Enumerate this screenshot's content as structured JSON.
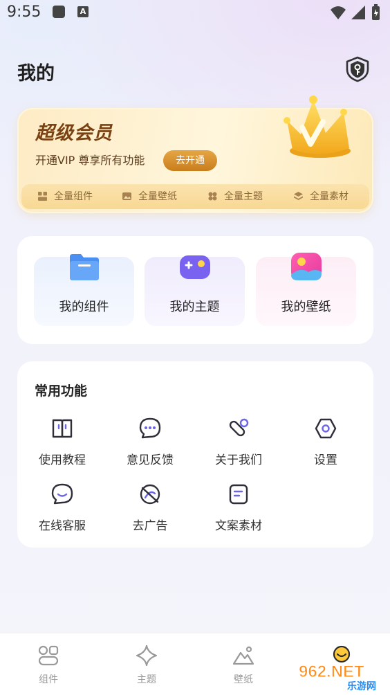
{
  "status_bar": {
    "time": "9:55",
    "ic2_letter": "A"
  },
  "header": {
    "title": "我的"
  },
  "vip": {
    "title": "超级会员",
    "subtitle": "开通VIP 尊享所有功能",
    "button": "去开通",
    "features": [
      "全量组件",
      "全量壁纸",
      "全量主题",
      "全量素材"
    ]
  },
  "my_items": [
    "我的组件",
    "我的主题",
    "我的壁纸"
  ],
  "functions": {
    "title": "常用功能",
    "items": [
      "使用教程",
      "意见反馈",
      "关于我们",
      "设置",
      "在线客服",
      "去广告",
      "文案素材"
    ]
  },
  "bottom_nav": {
    "items": [
      "组件",
      "主题",
      "壁纸",
      ""
    ]
  },
  "watermark": {
    "text": "962.NET",
    "sub": "乐游网"
  },
  "colors": {
    "accent": "#6b63e8",
    "gold": "#c97d1c"
  }
}
